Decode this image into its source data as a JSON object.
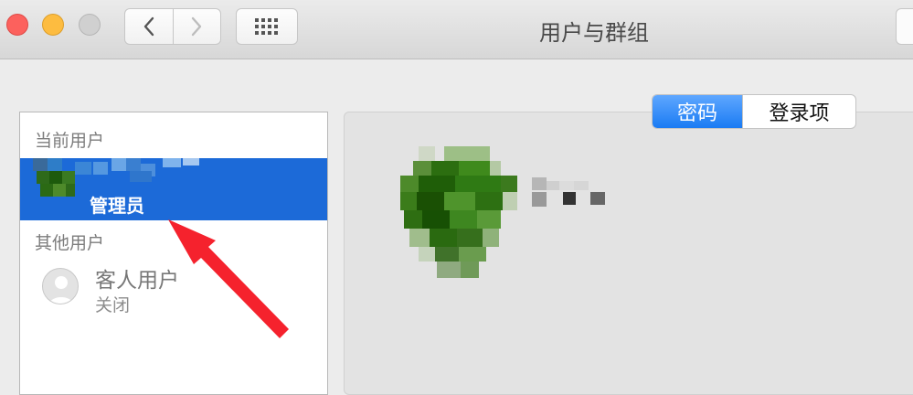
{
  "window": {
    "title": "用户与群组",
    "traffic_lights": [
      "close",
      "minimize",
      "zoom"
    ]
  },
  "toolbar": {
    "back_icon": "chevron-left-icon",
    "forward_icon": "chevron-right-icon",
    "grid_icon": "grid-icon"
  },
  "sidebar": {
    "current_users_header": "当前用户",
    "current_user": {
      "role": "管理员"
    },
    "other_users_header": "其他用户",
    "guest": {
      "name": "客人用户",
      "status": "关闭"
    }
  },
  "tabs": [
    {
      "label": "密码",
      "active": true
    },
    {
      "label": "登录项",
      "active": false
    }
  ],
  "colors": {
    "selection": "#1c6ad8",
    "tab_active": "#1a7bf3",
    "annotation_arrow": "#f5222d"
  }
}
